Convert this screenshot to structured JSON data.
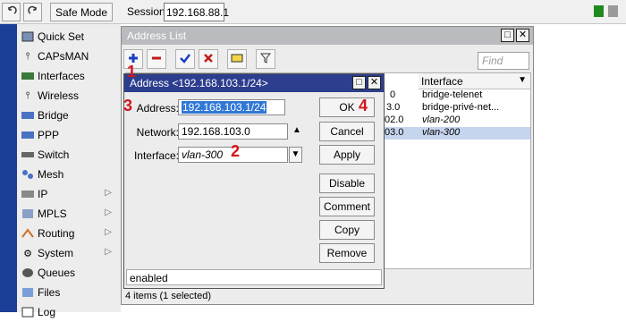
{
  "toolbar": {
    "undo_icon": "undo-icon",
    "redo_icon": "redo-icon",
    "safe_mode_label": "Safe Mode",
    "session_label": "Session:",
    "session_value": "192.168.88.1"
  },
  "sidebar": {
    "items": [
      {
        "label": "Quick Set",
        "icon": "quick-set-icon"
      },
      {
        "label": "CAPsMAN",
        "icon": "capsman-icon"
      },
      {
        "label": "Interfaces",
        "icon": "interfaces-icon"
      },
      {
        "label": "Wireless",
        "icon": "wireless-icon"
      },
      {
        "label": "Bridge",
        "icon": "bridge-icon"
      },
      {
        "label": "PPP",
        "icon": "ppp-icon"
      },
      {
        "label": "Switch",
        "icon": "switch-icon"
      },
      {
        "label": "Mesh",
        "icon": "mesh-icon"
      },
      {
        "label": "IP",
        "icon": "ip-icon"
      },
      {
        "label": "MPLS",
        "icon": "mpls-icon"
      },
      {
        "label": "Routing",
        "icon": "routing-icon"
      },
      {
        "label": "System",
        "icon": "system-icon"
      },
      {
        "label": "Queues",
        "icon": "queues-icon"
      },
      {
        "label": "Files",
        "icon": "files-icon"
      },
      {
        "label": "Log",
        "icon": "log-icon"
      }
    ]
  },
  "address_list": {
    "title": "Address List",
    "find_placeholder": "Find",
    "columns": {
      "interface": "Interface"
    },
    "rows": [
      {
        "address_tail": "0",
        "interface": "bridge-telenet",
        "selected": false
      },
      {
        "address_tail": "3.0",
        "interface": "bridge-privé-net...",
        "selected": false
      },
      {
        "address_tail": "02.0",
        "interface": "vlan-200",
        "selected": false
      },
      {
        "address_tail": "03.0",
        "interface": "vlan-300",
        "selected": true
      }
    ],
    "status": "4 items (1 selected)"
  },
  "dialog": {
    "title": "Address <192.168.103.1/24>",
    "address_label": "Address:",
    "address_value": "192.168.103.1/24",
    "network_label": "Network:",
    "network_value": "192.168.103.0",
    "interface_label": "Interface:",
    "interface_value": "vlan-300",
    "buttons": {
      "ok": "OK",
      "cancel": "Cancel",
      "apply": "Apply",
      "disable": "Disable",
      "comment": "Comment",
      "copy": "Copy",
      "remove": "Remove"
    },
    "status": "enabled"
  },
  "annotations": [
    "1",
    "2",
    "3",
    "4"
  ],
  "colors": {
    "sidebar_strip": "#1b3e97",
    "dialog_title_bg": "#2d3e8f",
    "annotation_red": "#d4141b",
    "selected_row": "#c6d5ee"
  }
}
